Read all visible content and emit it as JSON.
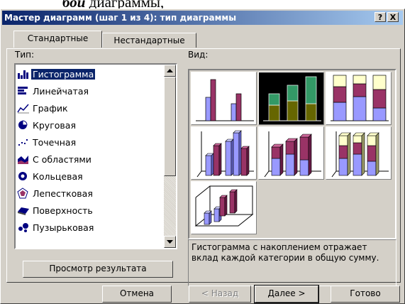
{
  "caption": {
    "text_plain": "",
    "text_bold": "бой",
    "text_tail": " диаграммы,"
  },
  "window": {
    "title": "Мастер диаграмм (шаг 1 из 4): тип диаграммы",
    "help": "?",
    "close": "X"
  },
  "tabs": [
    {
      "label": "Стандартные"
    },
    {
      "label": "Нестандартные"
    }
  ],
  "type_label": "Тип:",
  "view_label": "Вид:",
  "chart_types": [
    {
      "label": "Гистограмма",
      "icon": "histogram-icon",
      "selected": true
    },
    {
      "label": "Линейчатая",
      "icon": "bar-icon"
    },
    {
      "label": "График",
      "icon": "line-chart-icon"
    },
    {
      "label": "Круговая",
      "icon": "pie-chart-icon"
    },
    {
      "label": "Точечная",
      "icon": "scatter-icon"
    },
    {
      "label": "С областями",
      "icon": "area-chart-icon"
    },
    {
      "label": "Кольцевая",
      "icon": "doughnut-icon"
    },
    {
      "label": "Лепестковая",
      "icon": "radar-icon"
    },
    {
      "label": "Поверхность",
      "icon": "surface-icon"
    },
    {
      "label": "Пузырьковая",
      "icon": "bubble-icon"
    }
  ],
  "description": "Гистограмма с накоплением отражает вклад каждой категории в общую сумму.",
  "preview_button": "Просмотр результата",
  "buttons": {
    "cancel": "Отмена",
    "back": "< Назад",
    "next": "Далее >",
    "finish": "Готово"
  },
  "colors": {
    "title_start": "#0a246a",
    "title_end": "#a6caf0",
    "series1": "#9999ff",
    "series2": "#993366",
    "series3": "#ffffcc",
    "selected_series1": "#339966",
    "selected_series2": "#666600"
  }
}
